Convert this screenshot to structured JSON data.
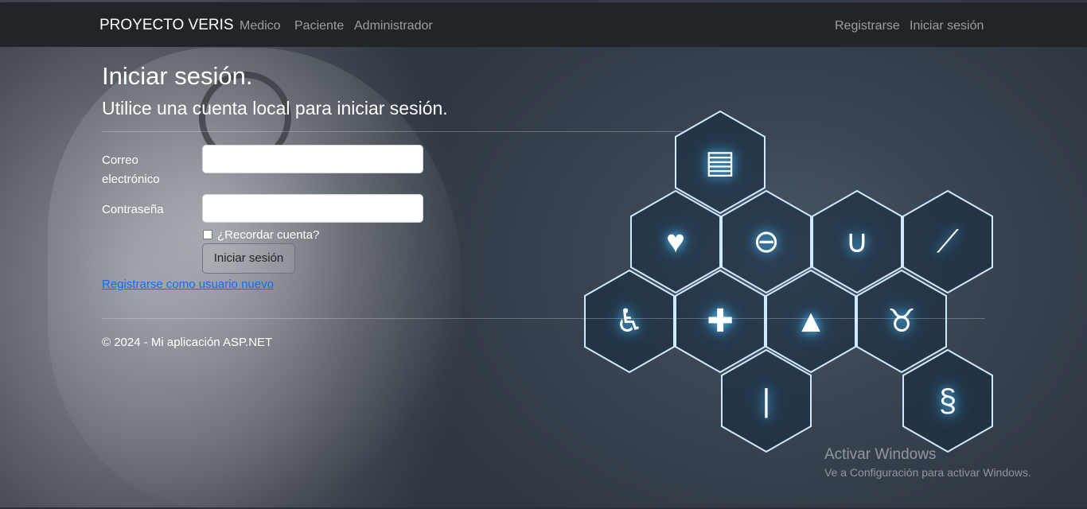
{
  "navbar": {
    "brand": "PROYECTO VERIS",
    "left_links": [
      "Medico",
      "Paciente",
      "Administrador"
    ],
    "right_links": [
      "Registrarse",
      "Iniciar sesión"
    ]
  },
  "login": {
    "title": "Iniciar sesión.",
    "subtitle": "Utilice una cuenta local para iniciar sesión.",
    "email_label": "Correo electrónico",
    "email_value": "",
    "password_label": "Contraseña",
    "password_value": "",
    "remember_label": "¿Recordar cuenta?",
    "remember_checked": false,
    "submit_label": "Iniciar sesión",
    "register_link": "Registrarse como usuario nuevo"
  },
  "footer": {
    "text": "© 2024 - Mi aplicación ASP.NET"
  },
  "background_icons": [
    "clipboard-icon",
    "heart-rate-icon",
    "pills-icon",
    "stethoscope-icon",
    "syringe-icon",
    "wheelchair-icon",
    "first-aid-kit-icon",
    "flask-icon",
    "tooth-icon",
    "thermometer-icon",
    "dna-icon"
  ],
  "watermark": {
    "title": "Activar Windows",
    "subtitle": "Ve a Configuración para activar Windows."
  },
  "colors": {
    "navbar_bg": "#212529",
    "link_blue": "#0d6efd",
    "glow": "#4fc3ff"
  }
}
